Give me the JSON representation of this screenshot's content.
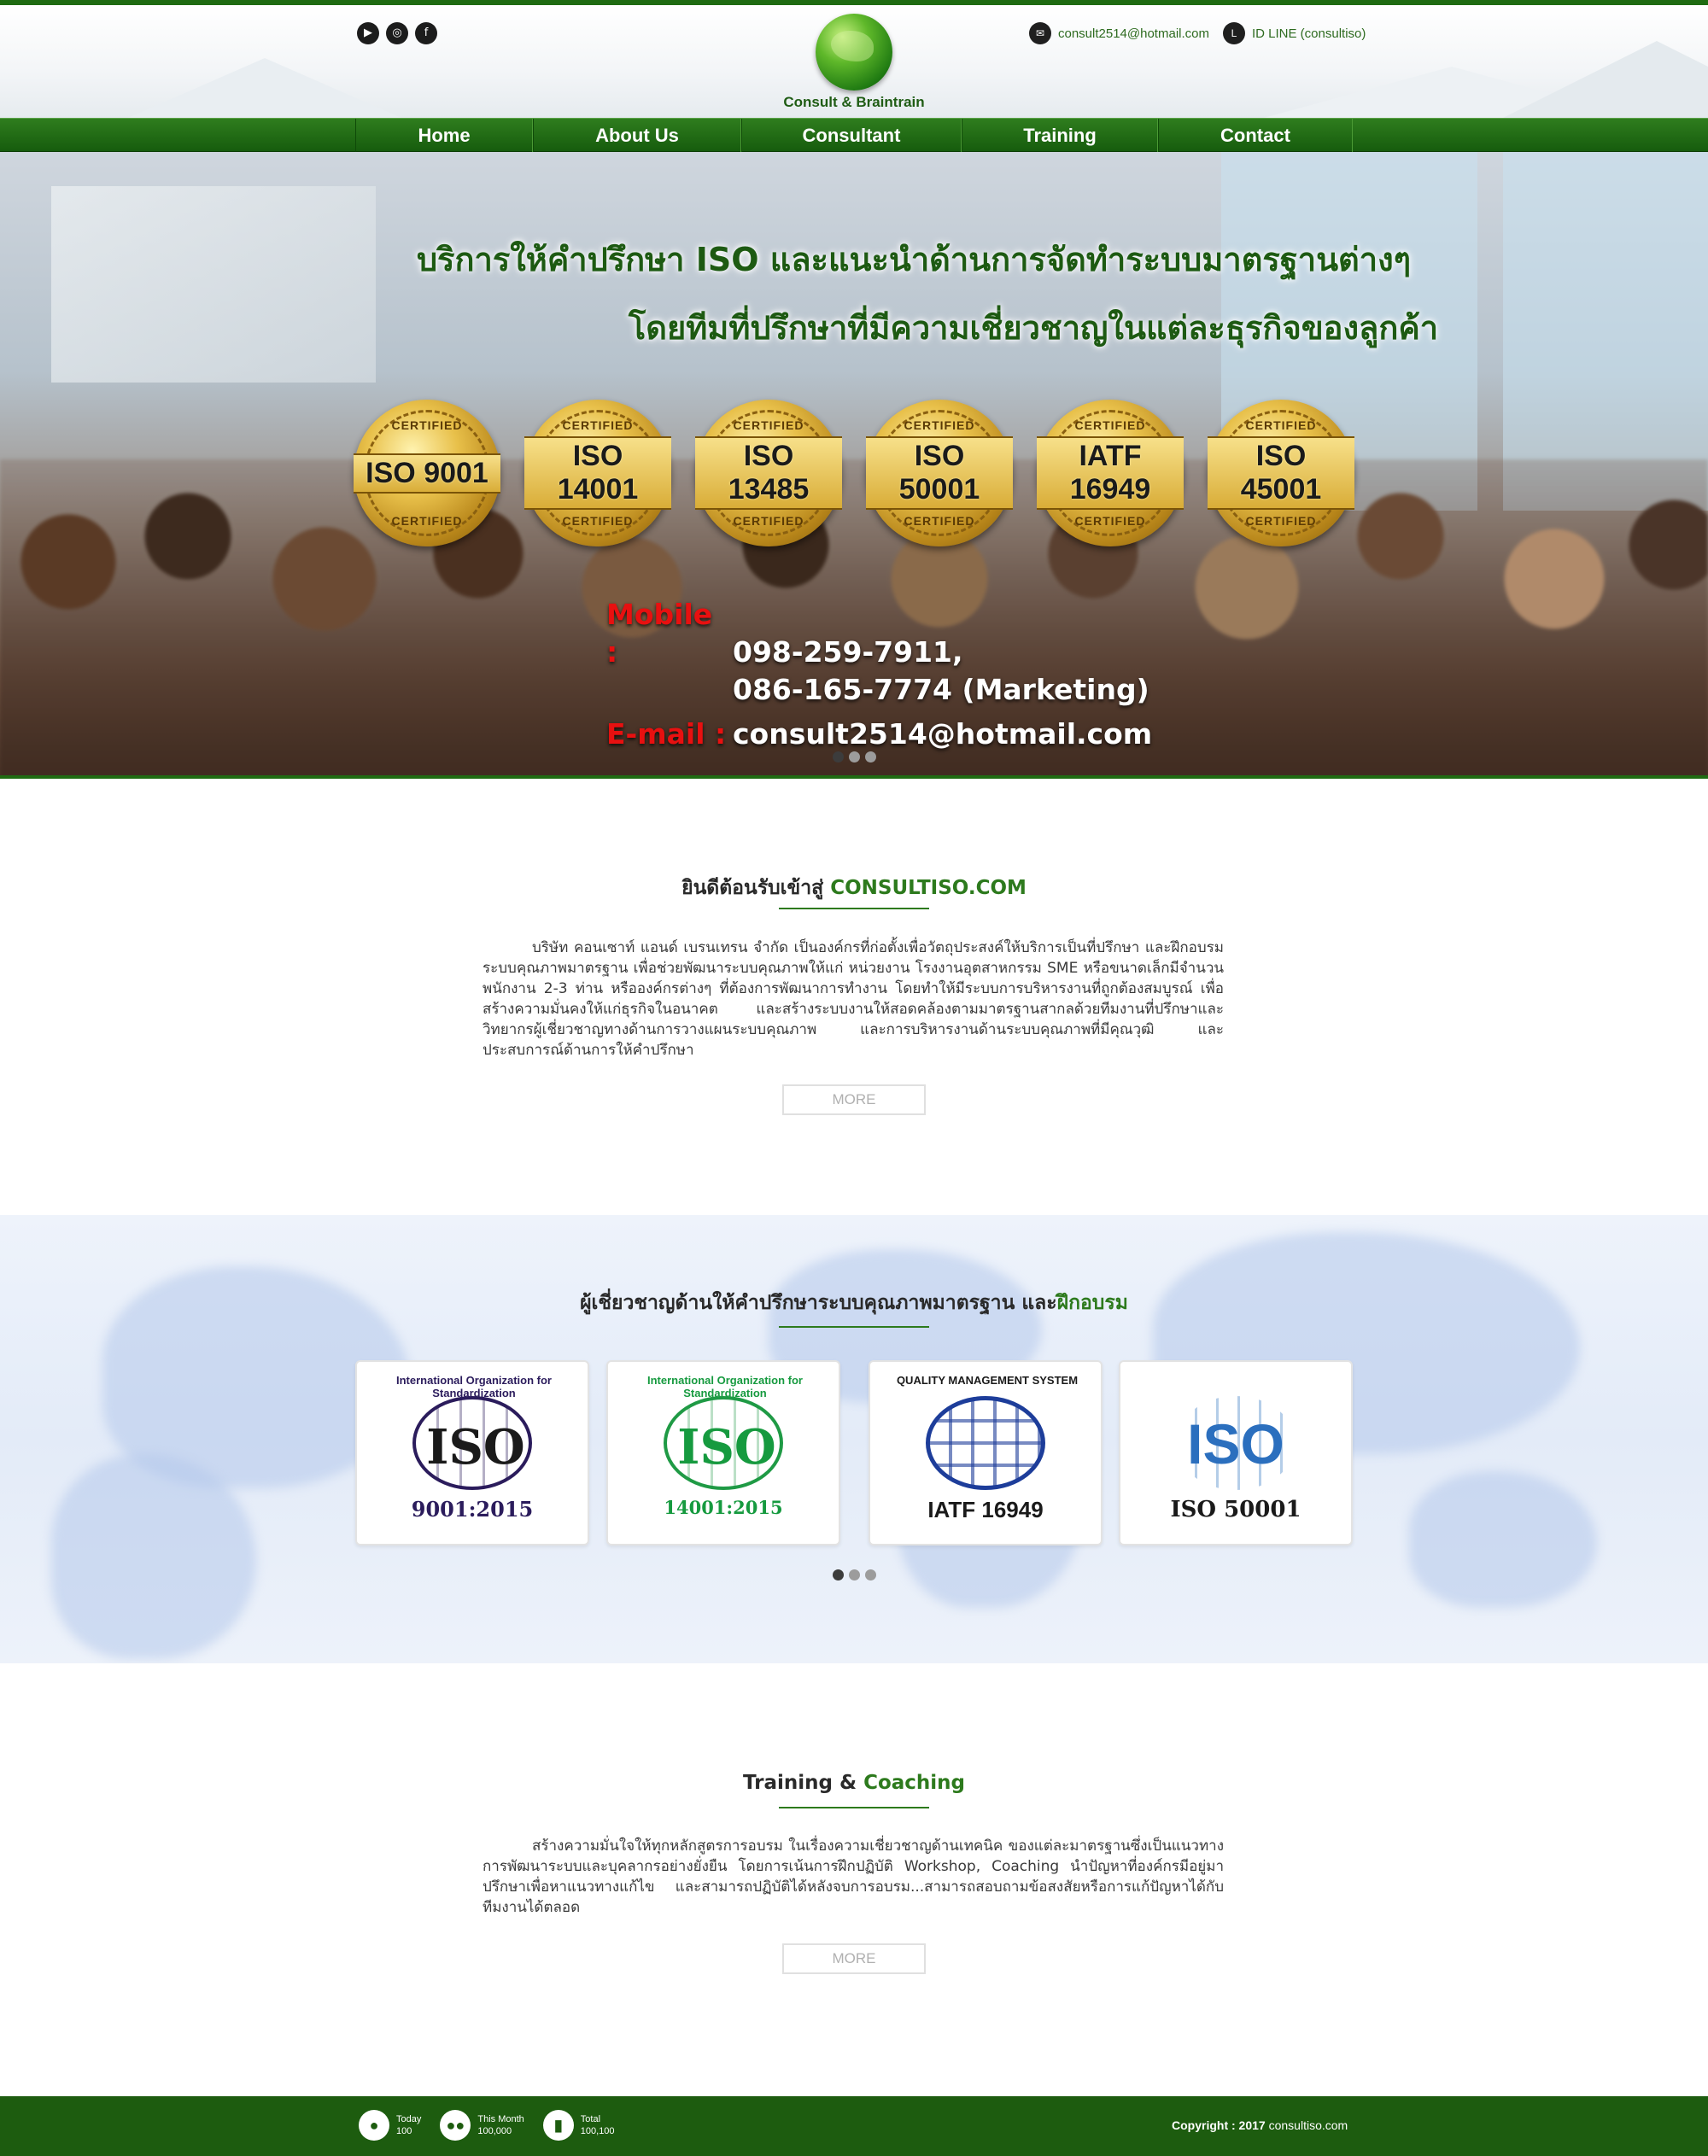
{
  "header": {
    "logo_text": "Consult & Braintrain",
    "social": [
      {
        "icon": "youtube-icon",
        "glyph": "▶"
      },
      {
        "icon": "instagram-icon",
        "glyph": "◎"
      },
      {
        "icon": "facebook-icon",
        "glyph": "f"
      }
    ],
    "email": "consult2514@hotmail.com",
    "line_id": "ID LINE (consultiso)"
  },
  "nav": {
    "items": [
      "Home",
      "About Us",
      "Consultant",
      "Training",
      "Contact"
    ]
  },
  "hero": {
    "title_line1": "บริการให้คำปรึกษา ISO และแนะนำด้านการจัดทำระบบมาตรฐานต่างๆ",
    "title_line2": "โดยทีมที่ปรึกษาที่มีความเชี่ยวชาญในแต่ละธุรกิจของลูกค้า",
    "certified_word": "CERTIFIED",
    "badges": [
      "ISO 9001",
      "ISO 14001",
      "ISO 13485",
      "ISO 50001",
      "IATF 16949",
      "ISO 45001"
    ],
    "mobile_label": "Mobile :",
    "mobile_1": "098-259-7911,",
    "mobile_2": "086-165-7774 (Marketing)",
    "email_label": "E-mail :",
    "email": "consult2514@hotmail.com",
    "slider_dots": 3,
    "active_dot": 1
  },
  "welcome": {
    "title_prefix": "ยินดีต้อนรับเข้าสู่",
    "title_brand": "CONSULTISO.COM",
    "body": "บริษัท คอนเซาท์ แอนด์ เบรนเทรน จำกัด เป็นองค์กรที่ก่อตั้งเพื่อวัตถุประสงค์ให้บริการเป็นที่ปรึกษา และฝึกอบรมระบบคุณภาพมาตรฐาน เพื่อช่วยพัฒนาระบบคุณภาพให้แก่ หน่วยงาน โรงงานอุตสาหกรรม SME หรือขนาดเล็กมีจำนวนพนักงาน 2-3 ท่าน หรือองค์กรต่างๆ ที่ต้องการพัฒนาการทำงาน โดยทำให้มีระบบการบริหารงานที่ถูกต้องสมบูรณ์ เพื่อสร้างความมั่นคงให้แก่ธุรกิจในอนาคต และสร้างระบบงานให้สอดคล้องตามมาตรฐานสากลด้วยทีมงานที่ปรึกษาและวิทยากรผู้เชี่ยวชาญทางด้านการวางแผนระบบคุณภาพ และการบริหารงานด้านระบบคุณภาพที่มีคุณวุฒิ และประสบการณ์ด้านการให้คำปรึกษา",
    "more": "MORE"
  },
  "experts": {
    "title_prefix": "ผู้เชี่ยวชาญด้านให้คำปรึกษาระบบคุณภาพมาตรฐาน และ",
    "title_green": "ฝึกอบรม",
    "cards": [
      {
        "mark": "ISO",
        "arc": "International Organization for Standardization",
        "caption": "9001:2015"
      },
      {
        "mark": "ISO",
        "arc": "International Organization for Standardization",
        "caption": "14001:2015"
      },
      {
        "mark": "",
        "arc": "QUALITY MANAGEMENT SYSTEM",
        "caption": "IATF 16949"
      },
      {
        "mark": "ISO",
        "arc": "",
        "caption": "ISO 50001"
      }
    ],
    "slider_dots": 3,
    "active_dot": 1
  },
  "training": {
    "title_prefix": "Training &",
    "title_green": "Coaching",
    "body": "สร้างความมั่นใจให้ทุกหลักสูตรการอบรม ในเรื่องความเชี่ยวชาญด้านเทคนิค ของแต่ละมาตรฐานซึ่งเป็นแนวทางการพัฒนาระบบและบุคลากรอย่างยั่งยืน โดยการเน้นการฝึกปฏิบัติ Workshop, Coaching นำปัญหาที่องค์กรมีอยู่มาปรึกษาเพื่อหาแนวทางแก้ไข และสามารถปฏิบัติได้หลังจบการอบรม...สามารถสอบถามข้อสงสัยหรือการแก้ปัญหาได้กับทีมงานได้ตลอด",
    "more": "MORE"
  },
  "footer": {
    "stats": [
      {
        "icon": "user-icon",
        "label": "Today",
        "value": "100"
      },
      {
        "icon": "users-icon",
        "label": "This Month",
        "value": "100,000"
      },
      {
        "icon": "bar-chart-icon",
        "label": "Total",
        "value": "100,100"
      }
    ],
    "copyright_label": "Copyright : 2017",
    "copyright_site": "consultiso.com"
  }
}
